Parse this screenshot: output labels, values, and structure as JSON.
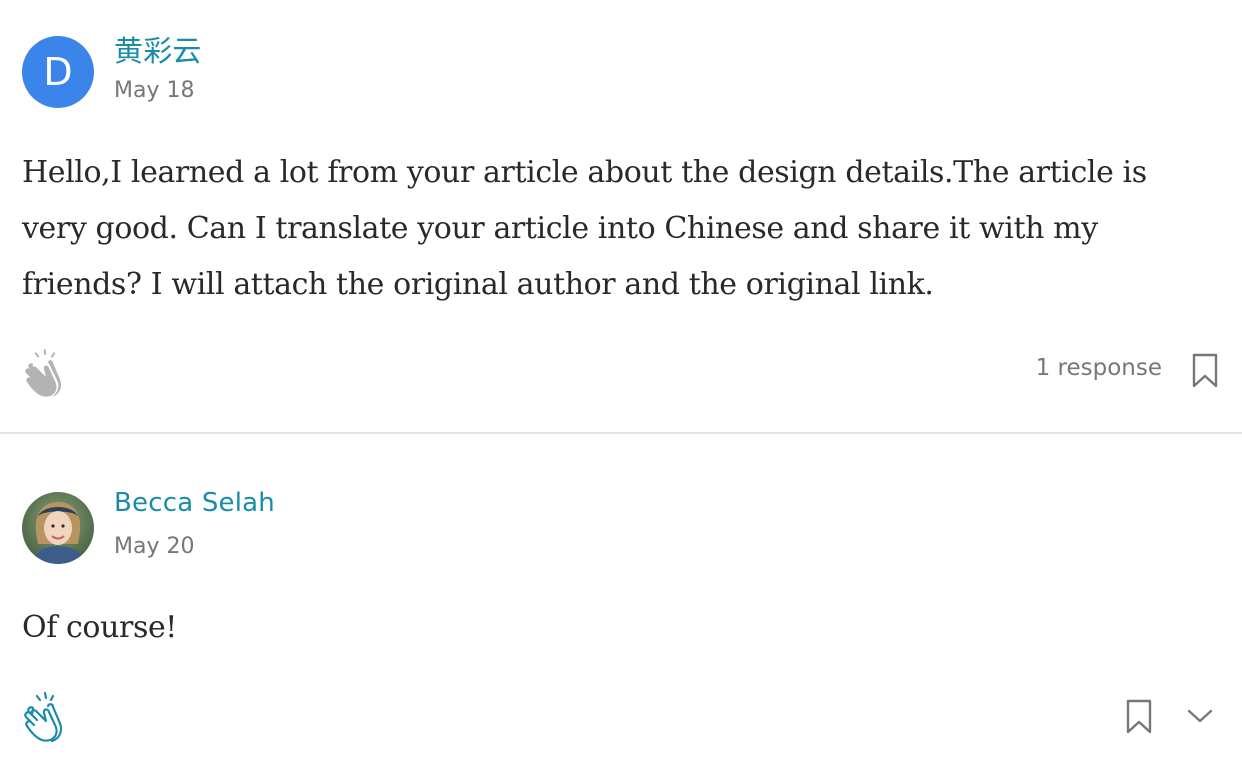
{
  "comments": [
    {
      "author": "黄彩云",
      "avatar_letter": "D",
      "avatar_color": "#3b85ea",
      "date": "May 18",
      "body": "Hello,I learned a lot from your article about the design details.The article is very good. Can I translate your article into Chinese and share it with my friends? I will attach the original author and the original link.",
      "clap_icon": "clap-icon",
      "responses": "1 response",
      "bookmark_icon": "bookmark-icon"
    },
    {
      "author": "Becca Selah",
      "date": "May 20",
      "body": "Of course!",
      "clap_icon": "clap-icon",
      "bookmark_icon": "bookmark-icon",
      "more_icon": "chevron-down-icon"
    }
  ],
  "colors": {
    "author_link": "#1a8bab",
    "meta_text": "#777777",
    "body_text": "#292929",
    "clap_inactive": "#b3b3b3",
    "clap_active": "#1a8bab",
    "divider": "#e6e6e6"
  }
}
